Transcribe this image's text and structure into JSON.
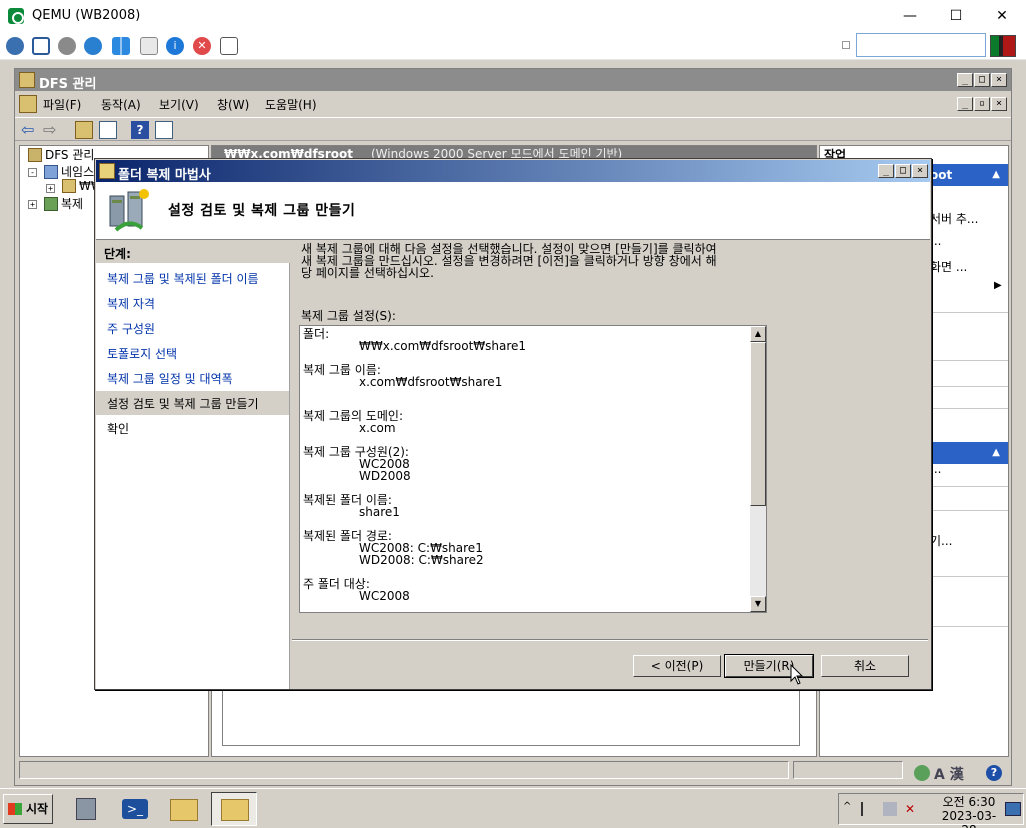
{
  "qemu": {
    "title": "QEMU (WB2008)",
    "controls": {
      "minimize": "—",
      "maximize": "☐",
      "close": "✕"
    }
  },
  "mmc": {
    "title": "DFS 관리",
    "menu": [
      "파일(F)",
      "동작(A)",
      "보기(V)",
      "창(W)",
      "도움말(H)"
    ],
    "tree": {
      "root": "DFS 관리",
      "namespace": "네임스",
      "namespace_child": "₩₩",
      "replication": "복제"
    },
    "center_header": {
      "path": "₩₩x.com₩dfsroot",
      "mode": "(Windows 2000 Server 모드에서 도메인 기반)"
    },
    "actions": {
      "title": "작업",
      "band1": "oot",
      "items": [
        "서버 추...",
        "...",
        "화면 ...",
        "...",
        "기..."
      ]
    }
  },
  "wizard": {
    "title": "폴더 복제 마법사",
    "header": "설정 검토 및 복제 그룹 만들기",
    "steps_title": "단계:",
    "steps": [
      "복제 그룹 및 복제된 폴더 이름",
      "복제 자격",
      "주 구성원",
      "토폴로지 선택",
      "복제 그룹 일정 및 대역폭",
      "설정 검토 및 복제 그룹 만들기",
      "확인"
    ],
    "description": "새 복제 그룹에 대해 다음 설정을 선택했습니다. 설정이 맞으면 [만들기]를 클릭하여\n새 복제 그룹을 만드십시오. 설정을 변경하려면 [이전]을 클릭하거나 방향 창에서 해\n당 페이지를 선택하십시오.",
    "settings_label": "복제 그룹 설정(S):",
    "settings": [
      {
        "label": "폴더:",
        "values": [
          "₩₩x.com₩dfsroot₩share1"
        ]
      },
      {
        "label": "복제 그룹 이름:",
        "values": [
          "x.com₩dfsroot₩share1"
        ]
      },
      {
        "label": "복제 그룹의 도메인:",
        "values": [
          "x.com"
        ]
      },
      {
        "label": "복제 그룹 구성원(2):",
        "values": [
          "WC2008",
          "WD2008"
        ]
      },
      {
        "label": "복제된 폴더 이름:",
        "values": [
          "share1"
        ]
      },
      {
        "label": "복제된 폴더 경로:",
        "values": [
          "WC2008: C:₩share1",
          "WD2008: C:₩share2"
        ]
      },
      {
        "label": "주 폴더 대상:",
        "values": [
          "WC2008"
        ]
      }
    ],
    "buttons": {
      "back": "< 이전(P)",
      "create": "만들기(R)",
      "cancel": "취소"
    }
  },
  "taskbar": {
    "start": "시작",
    "ime": "A 漢",
    "clock_time": "오전 6:30",
    "clock_date": "2023-03-28"
  }
}
